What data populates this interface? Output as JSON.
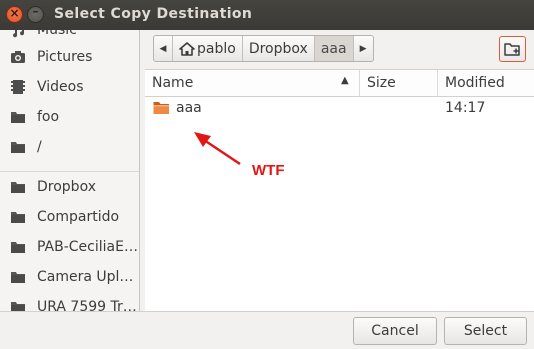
{
  "window": {
    "title": "Select Copy Destination"
  },
  "sidebar": {
    "items": [
      {
        "label": "Music",
        "icon": "music-icon"
      },
      {
        "label": "Pictures",
        "icon": "camera-icon"
      },
      {
        "label": "Videos",
        "icon": "film-icon"
      },
      {
        "label": "foo",
        "icon": "folder-icon"
      },
      {
        "label": "/",
        "icon": "folder-icon"
      },
      {
        "label": "Dropbox",
        "icon": "folder-icon"
      },
      {
        "label": "Compartido",
        "icon": "folder-icon"
      },
      {
        "label": "PAB-CeciliaE…",
        "icon": "folder-icon"
      },
      {
        "label": "Camera Uplo…",
        "icon": "folder-icon"
      },
      {
        "label": "URA 7599 Tr…",
        "icon": "folder-icon"
      }
    ]
  },
  "pathbar": {
    "segments": [
      "pablo",
      "Dropbox",
      "aaa"
    ],
    "home_icon": "home-icon"
  },
  "filelist": {
    "columns": {
      "name": "Name",
      "size": "Size",
      "modified": "Modified"
    },
    "rows": [
      {
        "name": "aaa",
        "size": "",
        "modified": "14:17",
        "icon": "folder-orange-icon"
      }
    ]
  },
  "annotation": {
    "text": "WTF",
    "color": "#e31616"
  },
  "buttons": {
    "cancel": "Cancel",
    "select": "Select"
  },
  "colors": {
    "titlebar": "#3c3b37",
    "accent": "#dd5b3d",
    "folder": "#555555",
    "folder_open": "#e7783a"
  }
}
